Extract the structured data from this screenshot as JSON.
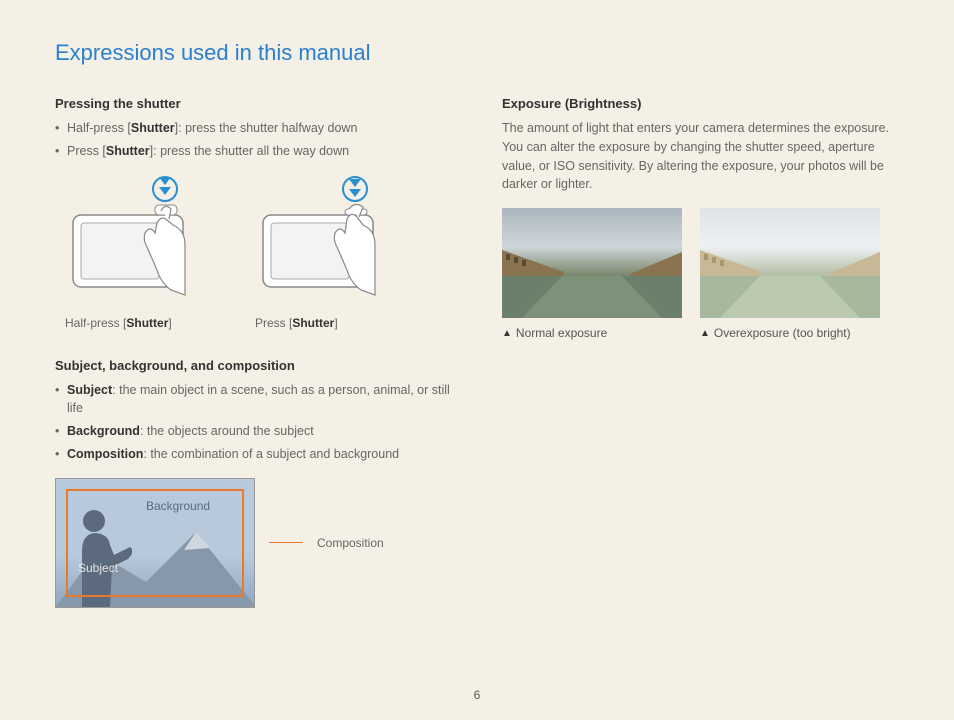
{
  "title": "Expressions used in this manual",
  "page_number": "6",
  "left": {
    "shutter": {
      "heading": "Pressing the shutter",
      "bullets": [
        {
          "pre": "Half-press [",
          "bold": "Shutter",
          "post": "]: press the shutter halfway down"
        },
        {
          "pre": "Press [",
          "bold": "Shutter",
          "post": "]: press the shutter all the way down"
        }
      ],
      "captions": {
        "half": {
          "pre": "Half-press [",
          "bold": "Shutter",
          "post": "]"
        },
        "full": {
          "pre": "Press [",
          "bold": "Shutter",
          "post": "]"
        }
      }
    },
    "sbc": {
      "heading": "Subject, background, and composition",
      "bullets": [
        {
          "bold": "Subject",
          "post": ": the main object in a scene, such as a person, animal, or still life"
        },
        {
          "bold": "Background",
          "post": ": the objects around the subject"
        },
        {
          "bold": "Composition",
          "post": ": the combination of a subject and background"
        }
      ],
      "labels": {
        "background": "Background",
        "subject": "Subject",
        "composition": "Composition"
      }
    }
  },
  "right": {
    "exposure": {
      "heading": "Exposure (Brightness)",
      "paragraph": "The amount of light that enters your camera determines the exposure. You can alter the exposure by changing the shutter speed, aperture value, or ISO sensitivity. By altering the exposure, your photos will be darker or lighter.",
      "captions": {
        "normal": "Normal exposure",
        "over": "Overexposure (too bright)"
      }
    }
  }
}
